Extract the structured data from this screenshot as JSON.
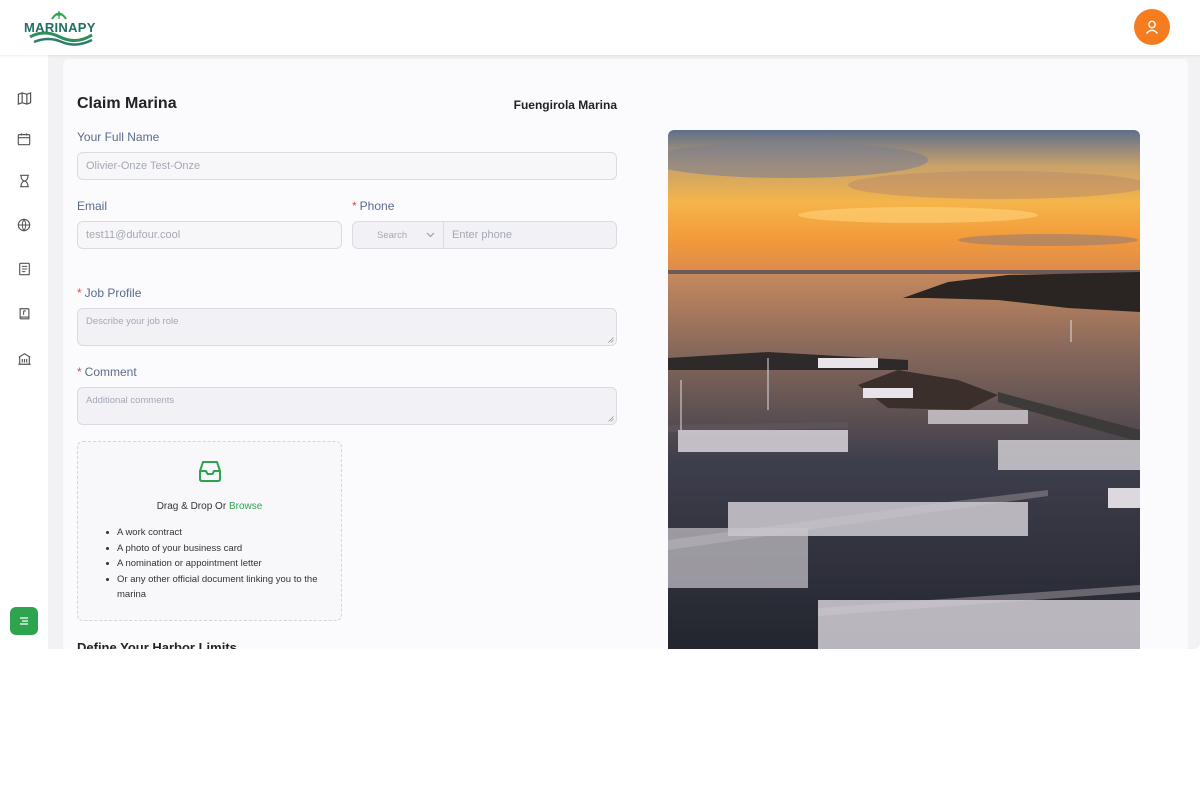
{
  "brand": {
    "name": "MARINAPY",
    "accent": "#2ea44f",
    "logo_color": "#1f6f63",
    "avatar_color": "#f57c1f"
  },
  "header": {
    "avatar_icon": "user-icon"
  },
  "sidebar": {
    "items": [
      {
        "icon": "map-icon"
      },
      {
        "icon": "calendar-icon"
      },
      {
        "icon": "hourglass-icon"
      },
      {
        "icon": "globe-icon"
      },
      {
        "icon": "document-list-icon"
      },
      {
        "icon": "book-icon"
      },
      {
        "icon": "building-icon"
      }
    ],
    "toggle_icon": "menu-icon"
  },
  "form": {
    "title": "Claim Marina",
    "marina_name": "Fuengirola Marina",
    "full_name": {
      "label": "Your Full Name",
      "value": "Olivier-Onze Test-Onze"
    },
    "email": {
      "label": "Email",
      "value": "test11@dufour.cool"
    },
    "phone": {
      "label": "Phone",
      "select_placeholder": "Search",
      "placeholder": "Enter phone"
    },
    "job_profile": {
      "label": "Job Profile",
      "placeholder": "Describe your job role"
    },
    "comment": {
      "label": "Comment",
      "placeholder": "Additional comments"
    },
    "upload": {
      "icon": "inbox-icon",
      "text": "Drag & Drop Or ",
      "browse": "Browse",
      "items": [
        "A work contract",
        "A photo of your business card",
        "A nomination or appointment letter",
        "Or any other official document linking you to the marina"
      ]
    },
    "next_section": "Define Your Harbor Limits"
  }
}
